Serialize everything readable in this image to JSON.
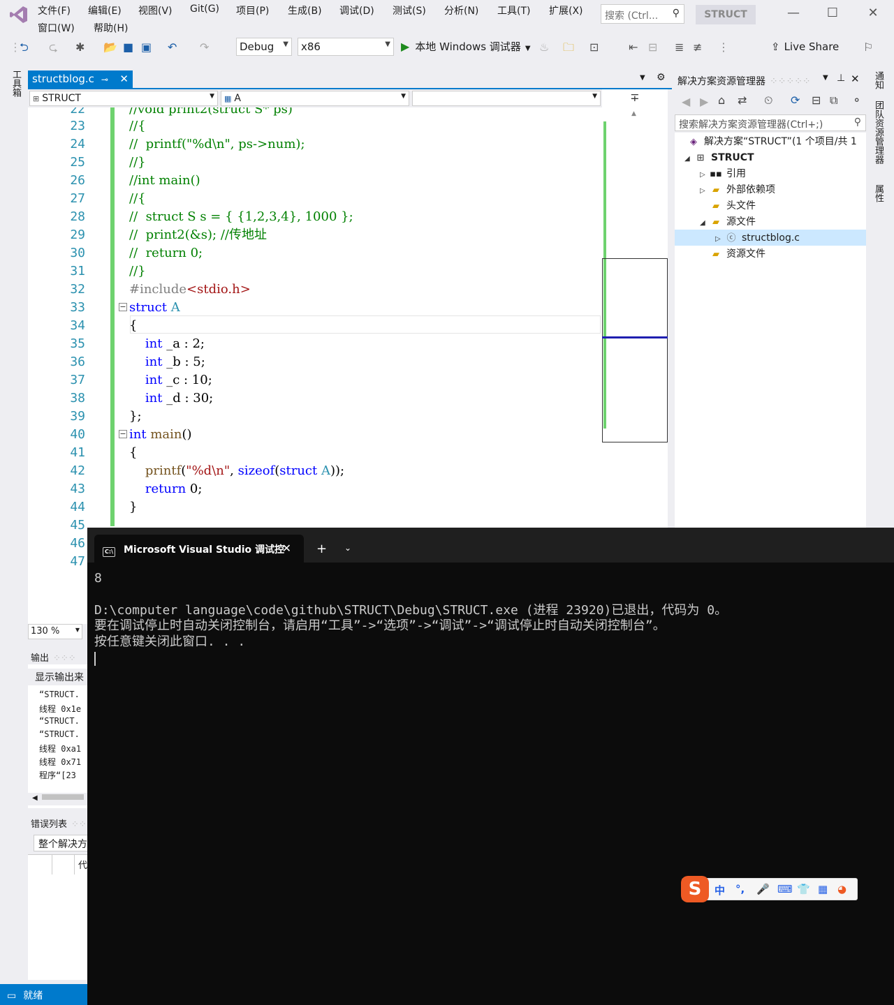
{
  "menu": [
    "文件(F)",
    "编辑(E)",
    "视图(V)",
    "Git(G)",
    "项目(P)",
    "生成(B)",
    "调试(D)",
    "测试(S)",
    "分析(N)",
    "工具(T)",
    "扩展(X)",
    "窗口(W)",
    "帮助(H)"
  ],
  "search": {
    "placeholder": "搜索 (Ctrl..."
  },
  "project_badge": "STRUCT",
  "toolbar": {
    "config": "Debug",
    "platform": "x86",
    "run_label": "本地 Windows 调试器",
    "live_share": "Live Share"
  },
  "toolbox_tab": "工具箱",
  "editor": {
    "tab_title": "structblog.c",
    "nav_scope": "STRUCT",
    "nav_type": "A",
    "nav_member": "",
    "zoom": "130 %",
    "line_numbers": [
      "22",
      "23",
      "24",
      "25",
      "26",
      "27",
      "28",
      "29",
      "30",
      "31",
      "32",
      "33",
      "34",
      "35",
      "36",
      "37",
      "38",
      "39",
      "40",
      "41",
      "42",
      "43",
      "44",
      "45",
      "46",
      "47"
    ]
  },
  "solution_explorer": {
    "title": "解决方案资源管理器",
    "search_placeholder": "搜索解决方案资源管理器(Ctrl+;)",
    "solution": "解决方案“STRUCT”(1 个项目/共 1",
    "project": "STRUCT",
    "items": [
      "引用",
      "外部依赖项",
      "头文件",
      "源文件",
      "structblog.c",
      "资源文件"
    ]
  },
  "right_tabs": [
    "通知",
    "团队资源管理器",
    "属性"
  ],
  "output": {
    "title": "输出",
    "source_label": "显示输出来",
    "lines": [
      "“STRUCT.",
      "线程 0x1e",
      "“STRUCT.",
      "“STRUCT.",
      "线程 0xa1",
      "线程 0x71",
      "程序“[23"
    ]
  },
  "error_list": {
    "title": "错误列表",
    "scope": "整个解决方",
    "col_code": "代"
  },
  "status": {
    "text": "就绪"
  },
  "console": {
    "tab_title": "Microsoft Visual Studio 调试控",
    "lines": [
      "8",
      "",
      "D:\\computer language\\code\\github\\STRUCT\\Debug\\STRUCT.exe (进程 23920)已退出，代码为 0。",
      "要在调试停止时自动关闭控制台，请启用“工具”->“选项”->“调试”->“调试停止时自动关闭控制台”。",
      "按任意键关闭此窗口. . ."
    ]
  },
  "ime": {
    "mode": "中"
  }
}
